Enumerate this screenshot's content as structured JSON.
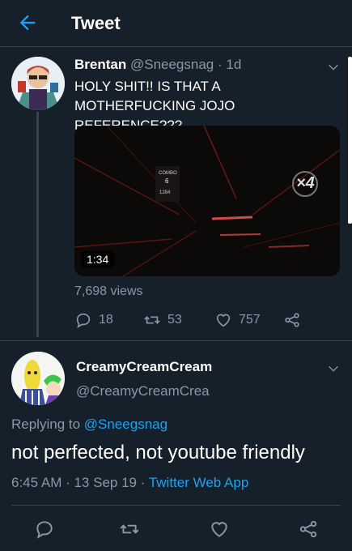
{
  "header": {
    "title": "Tweet"
  },
  "parent_tweet": {
    "name": "Brentan",
    "handle": "@Sneegsnag",
    "time": "· 1d",
    "text": "HOLY SHIT!! IS THAT A MOTHERFUCKING JOJO REFERENCE???",
    "video": {
      "duration": "1:34",
      "combo_label": "COMBO",
      "combo_value": "6",
      "score": "1284",
      "multiplier": "×4"
    },
    "views": "7,698 views",
    "actions": {
      "replies": "18",
      "retweets": "53",
      "likes": "757"
    }
  },
  "main_tweet": {
    "name": "CreamyCreamCream",
    "handle": "@CreamyCreamCrea",
    "replying_prefix": "Replying to",
    "replying_to": "@Sneegsnag",
    "text": "not perfected, not youtube friendly",
    "timestamp": "6:45 AM · 13 Sep 19 ·",
    "app": "Twitter Web App"
  },
  "colors": {
    "background": "#15202b",
    "accent": "#1da1f2",
    "secondary_text": "#8899a6",
    "divider": "#38444d"
  }
}
